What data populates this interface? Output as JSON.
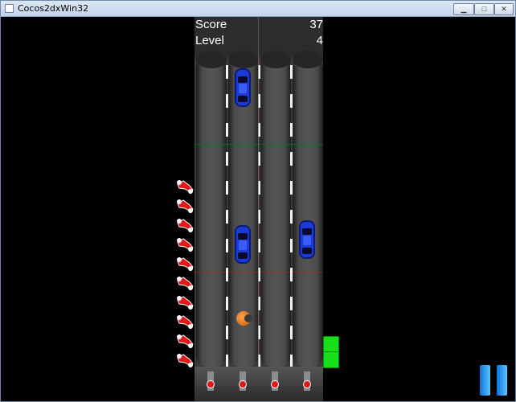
{
  "window": {
    "title": "Cocos2dxWin32"
  },
  "hud": {
    "score_label": "Score",
    "score_value": "37",
    "level_label": "Level",
    "level_value": "4"
  },
  "lives": {
    "count": 10,
    "icon": "red-car-icon"
  },
  "enemies": [
    {
      "lane": 2,
      "color": "#1c3bd6"
    },
    {
      "lane": 2,
      "color": "#1c3bd6"
    },
    {
      "lane": 4,
      "color": "#1c3bd6"
    }
  ],
  "player": {
    "lane": 2,
    "color": "#ff8c1a"
  },
  "colors": {
    "accent_green": "#18e018",
    "pause_blue": "#1a8cf0",
    "life_red": "#e01818"
  },
  "controls": {
    "pause_icon": "pause-icon"
  }
}
